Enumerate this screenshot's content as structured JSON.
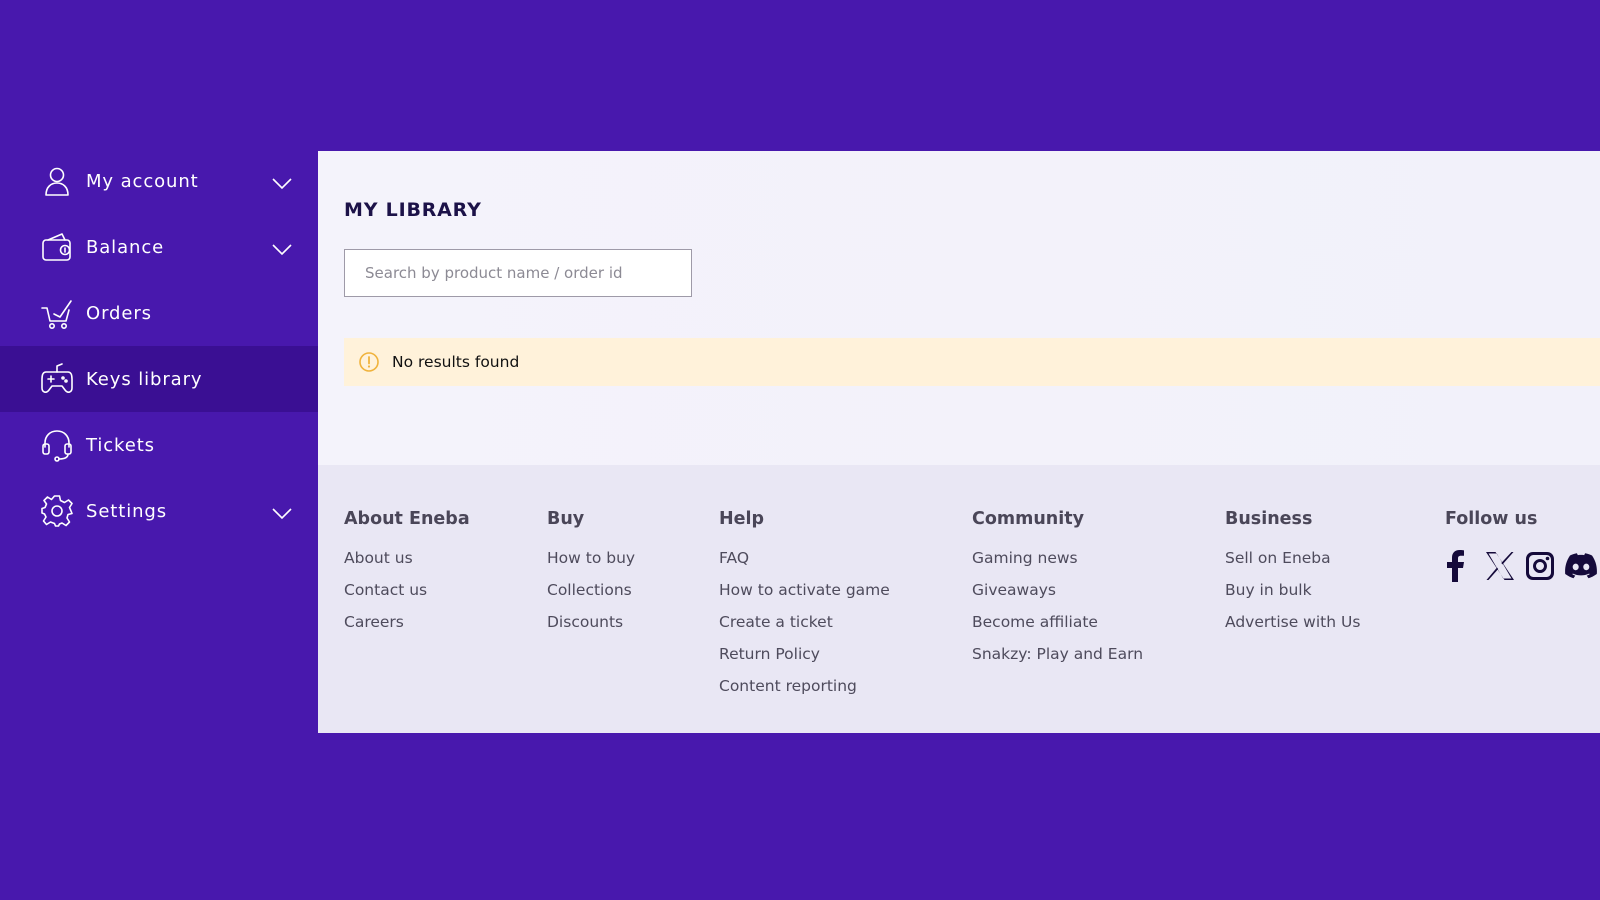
{
  "sidebar": {
    "items": [
      {
        "label": "My account",
        "icon": "user-icon",
        "expandable": true
      },
      {
        "label": "Balance",
        "icon": "wallet-icon",
        "expandable": true
      },
      {
        "label": "Orders",
        "icon": "cart-icon",
        "expandable": false
      },
      {
        "label": "Keys library",
        "icon": "gamepad-icon",
        "expandable": false,
        "active": true
      },
      {
        "label": "Tickets",
        "icon": "headset-icon",
        "expandable": false
      },
      {
        "label": "Settings",
        "icon": "gear-icon",
        "expandable": true
      }
    ]
  },
  "main": {
    "title": "MY LIBRARY",
    "search": {
      "placeholder": "Search by product name / order id",
      "value": ""
    },
    "alert": {
      "text": "No results found",
      "icon": "info-circle-icon"
    }
  },
  "footer": {
    "columns": [
      {
        "heading": "About Eneba",
        "links": [
          "About us",
          "Contact us",
          "Careers"
        ]
      },
      {
        "heading": "Buy",
        "links": [
          "How to buy",
          "Collections",
          "Discounts"
        ]
      },
      {
        "heading": "Help",
        "links": [
          "FAQ",
          "How to activate game",
          "Create a ticket",
          "Return Policy",
          "Content reporting"
        ]
      },
      {
        "heading": "Community",
        "links": [
          "Gaming news",
          "Giveaways",
          "Become affiliate",
          "Snakzy: Play and Earn"
        ]
      },
      {
        "heading": "Business",
        "links": [
          "Sell on Eneba",
          "Buy in bulk",
          "Advertise with Us"
        ]
      }
    ],
    "follow": {
      "heading": "Follow us",
      "icons": [
        "facebook-icon",
        "x-icon",
        "instagram-icon",
        "discord-icon"
      ]
    }
  },
  "colors": {
    "background": "#4818ad",
    "sidebar_active": "#3a0f93",
    "panel": "#f4f3fb",
    "footer": "#e9e7f4",
    "alert": "#fff2da",
    "alert_icon": "#f0b33c"
  }
}
